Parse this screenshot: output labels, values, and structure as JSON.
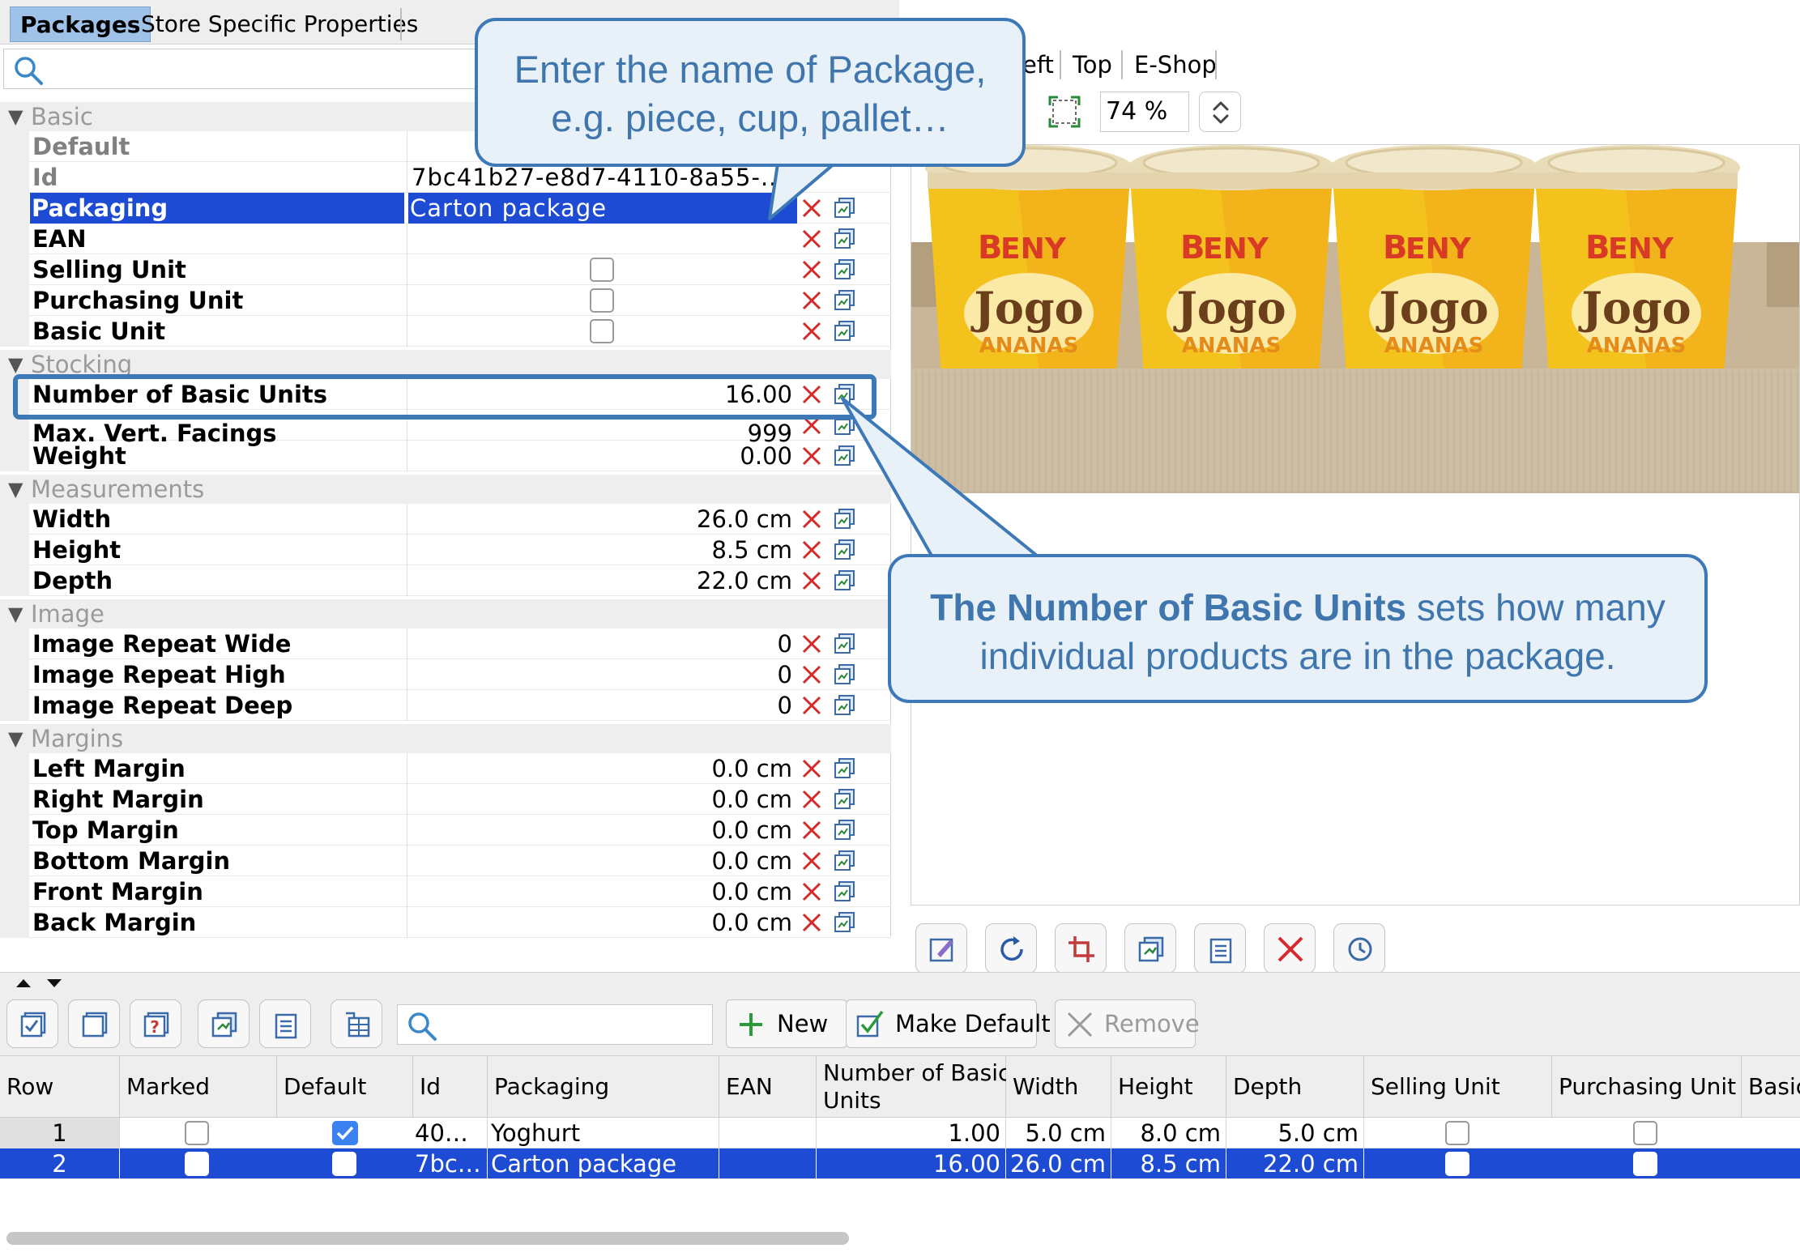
{
  "tabs": [
    {
      "label": "Packages",
      "active": true
    },
    {
      "label": "Store Specific Properties",
      "active": false
    }
  ],
  "properties": {
    "groups": {
      "basic": "Basic",
      "stocking": "Stocking",
      "measurements": "Measurements",
      "image": "Image",
      "margins": "Margins"
    },
    "default_label": "Default",
    "id": {
      "label": "Id",
      "value": "7bc41b27-e8d7-4110-8a55-.."
    },
    "packaging": {
      "label": "Packaging",
      "value": "Carton package"
    },
    "ean": {
      "label": "EAN",
      "value": ""
    },
    "selling_unit": {
      "label": "Selling Unit"
    },
    "purchasing_unit": {
      "label": "Purchasing Unit"
    },
    "basic_unit": {
      "label": "Basic Unit"
    },
    "number_basic_units": {
      "label": "Number of Basic Units",
      "value": "16.00"
    },
    "max_vert_facings": {
      "label": "Max. Vert. Facings",
      "value": "999"
    },
    "weight": {
      "label": "Weight",
      "value": "0.00"
    },
    "width": {
      "label": "Width",
      "value": "26.0 cm"
    },
    "height": {
      "label": "Height",
      "value": "8.5 cm"
    },
    "depth": {
      "label": "Depth",
      "value": "22.0 cm"
    },
    "image_repeat_wide": {
      "label": "Image Repeat Wide",
      "value": "0"
    },
    "image_repeat_high": {
      "label": "Image Repeat High",
      "value": "0"
    },
    "image_repeat_deep": {
      "label": "Image Repeat Deep",
      "value": "0"
    },
    "left_margin": {
      "label": "Left Margin",
      "value": "0.0 cm"
    },
    "right_margin": {
      "label": "Right Margin",
      "value": "0.0 cm"
    },
    "top_margin": {
      "label": "Top Margin",
      "value": "0.0 cm"
    },
    "bottom_margin": {
      "label": "Bottom Margin",
      "value": "0.0 cm"
    },
    "front_margin": {
      "label": "Front Margin",
      "value": "0.0 cm"
    },
    "back_margin": {
      "label": "Back Margin",
      "value": "0.0 cm"
    }
  },
  "view_tabs": {
    "left": "eft",
    "top": "Top",
    "eshop": "E-Shop"
  },
  "zoom": "74 %",
  "product": {
    "brand": "ENY",
    "brand_initial": "B",
    "name": "Jogo",
    "flavor": "ANANAS"
  },
  "bottom_toolbar": {
    "new": "New",
    "make_default": "Make Default",
    "remove": "Remove"
  },
  "table": {
    "headers": {
      "row": "Row",
      "marked": "Marked",
      "default": "Default",
      "id": "Id",
      "packaging": "Packaging",
      "ean": "EAN",
      "nbu_line1": "Number of Basic",
      "nbu_line2": "Units",
      "width": "Width",
      "height": "Height",
      "depth": "Depth",
      "selling_unit": "Selling Unit",
      "purchasing_unit": "Purchasing Unit",
      "basic": "Basic"
    },
    "rows": [
      {
        "row": "1",
        "marked": false,
        "default": true,
        "id": "40…",
        "packaging": "Yoghurt",
        "ean": "",
        "nbu": "1.00",
        "width": "5.0 cm",
        "height": "8.0 cm",
        "depth": "5.0 cm"
      },
      {
        "row": "2",
        "marked": false,
        "default": false,
        "id": "7bc…",
        "packaging": "Carton package",
        "ean": "",
        "nbu": "16.00",
        "width": "26.0 cm",
        "height": "8.5 cm",
        "depth": "22.0 cm"
      }
    ]
  },
  "callouts": {
    "package_line1": "Enter the name of Package,",
    "package_line2": "e.g. piece, cup, pallet…",
    "units_bold": "The Number of Basic Units",
    "units_rest": " sets how many",
    "units_line2": "individual products are in the package."
  },
  "colors": {
    "selection": "#1d4bd3",
    "callout_border": "#3d78b7",
    "callout_text": "#3f76ad",
    "delete_red": "#d42a2a"
  }
}
